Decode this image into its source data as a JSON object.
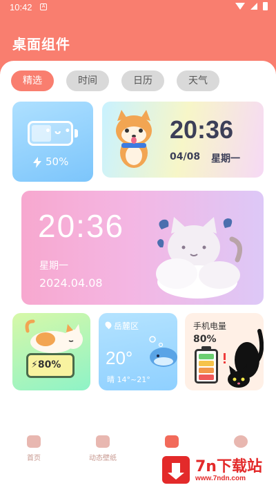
{
  "status_bar": {
    "time": "10:42",
    "notification_icon": "A"
  },
  "header": {
    "title": "桌面组件"
  },
  "tabs": [
    {
      "label": "精选",
      "active": true
    },
    {
      "label": "时间",
      "active": false
    },
    {
      "label": "日历",
      "active": false
    },
    {
      "label": "天气",
      "active": false
    }
  ],
  "widgets": {
    "battery_blue": {
      "percent": "50%",
      "face": "• ᴗ •"
    },
    "clock_dog": {
      "time": "20:36",
      "date": "04/08",
      "weekday": "星期一"
    },
    "clock_pink": {
      "time": "20:36",
      "weekday": "星期一",
      "date": "2024.04.08"
    },
    "cat_battery": {
      "percent": "80%"
    },
    "weather": {
      "location": "岳麓区",
      "temp": "20°",
      "desc": "晴  14°~21°"
    },
    "phone_battery": {
      "title": "手机电量",
      "percent": "80%"
    }
  },
  "nav": [
    {
      "label": "首页"
    },
    {
      "label": "动态壁纸"
    },
    {
      "label": ""
    },
    {
      "label": ""
    }
  ],
  "watermark": {
    "title": "7n下载站",
    "url": "www.7ndn.com"
  },
  "colors": {
    "accent": "#f97e6f",
    "tab_inactive": "#d9d9d9"
  }
}
